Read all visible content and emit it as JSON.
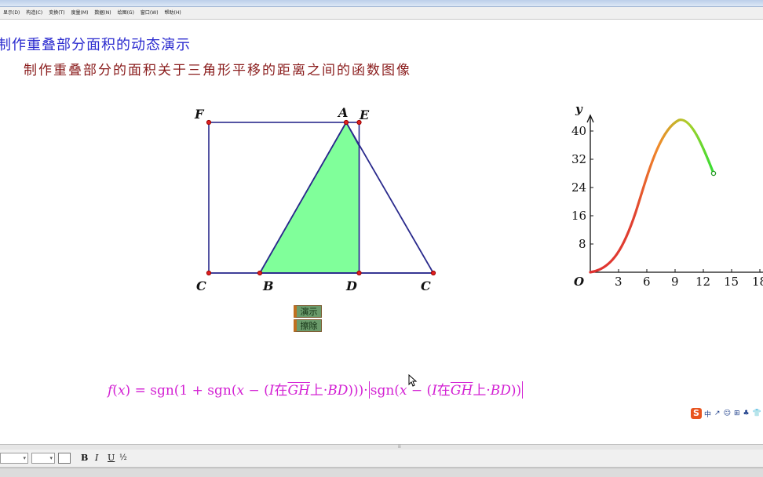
{
  "menu": {
    "items": [
      "显示(D)",
      "构造(C)",
      "变换(T)",
      "度量(M)",
      "数据(N)",
      "绘图(G)",
      "窗口(W)",
      "帮助(H)"
    ]
  },
  "page": {
    "title": "制作重叠部分面积的动态演示",
    "subtitle": "制作重叠部分的面积关于三角形平移的距离之间的函数图像"
  },
  "geometry": {
    "points": {
      "F": "F",
      "A": "A",
      "E": "E",
      "C_left": "C",
      "B": "B",
      "D": "D",
      "C_right": "C"
    },
    "colors": {
      "outline": "#2a2a8c",
      "fill": "#80ff9a",
      "point": "#e02020"
    }
  },
  "buttons": {
    "animate_label": "演示",
    "erase_label": "擦除"
  },
  "graph": {
    "y_label": "y",
    "origin_label": "O",
    "x_ticks": [
      "3",
      "6",
      "9",
      "12",
      "15",
      "18"
    ],
    "y_ticks": [
      "8",
      "16",
      "24",
      "32",
      "40"
    ],
    "curve_colors": {
      "start": "#e03030",
      "mid": "#f08a2a",
      "end": "#33dd33"
    }
  },
  "formula": {
    "f": "f",
    "x": "x",
    "open": "(",
    "close_eq": ")  =  sgn(1  +  sgn(",
    "minus1": "  −  (",
    "I1": "I",
    "zai1": "在",
    "GH1": "GH",
    "shang1": "上",
    "dot_bd1": "·",
    "BD1": "BD",
    "close1": ")))·",
    "sgn2": "sgn(",
    "x2": "x",
    "minus2": "  −  (",
    "I2": "I",
    "zai2": "在",
    "GH2": "GH",
    "shang2": "上",
    "dot_bd2": "·",
    "BD2": "BD",
    "close2": "))"
  },
  "ime": {
    "logo": "S",
    "items": [
      "中",
      "↗",
      "☺",
      "⊞",
      "♣",
      "👕"
    ]
  },
  "toolbar": {
    "bold": "B",
    "italic": "I",
    "underline": "U",
    "fraction": "½"
  }
}
